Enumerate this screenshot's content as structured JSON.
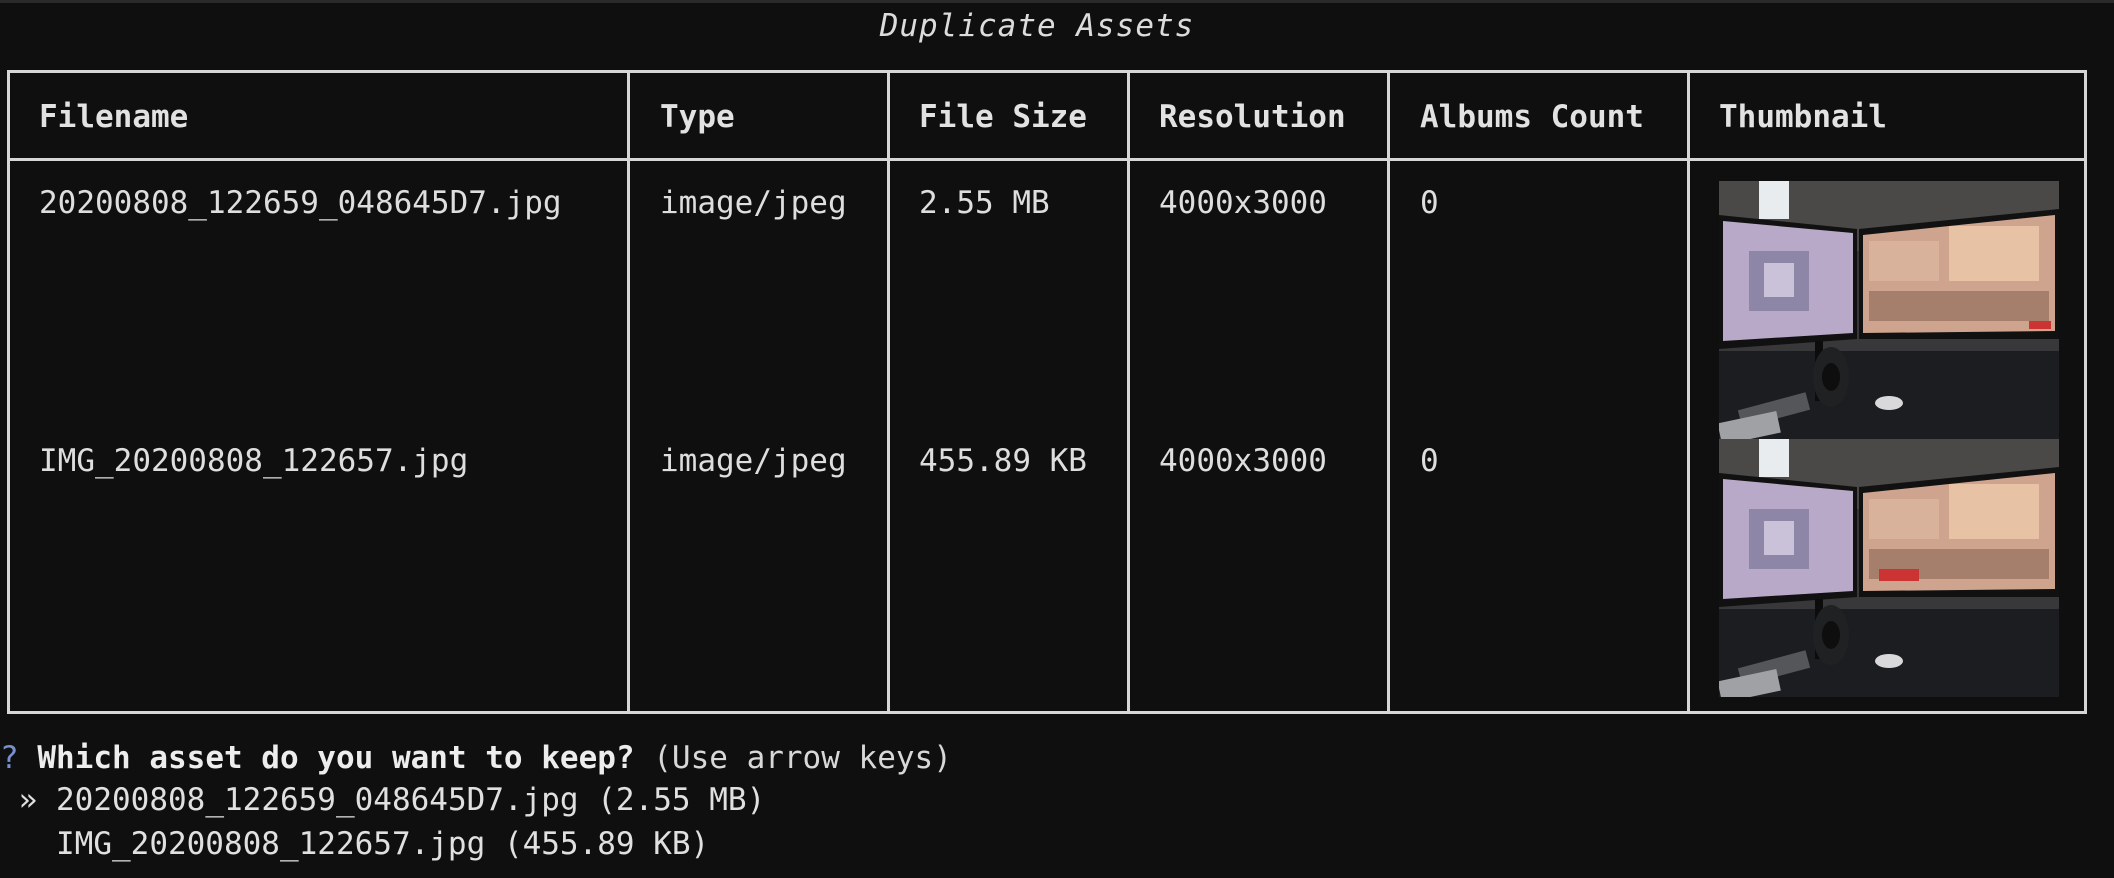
{
  "caption": "Duplicate Assets",
  "table": {
    "headers": [
      "Filename",
      "Type",
      "File Size",
      "Resolution",
      "Albums Count",
      "Thumbnail"
    ],
    "rows": [
      {
        "filename": "20200808_122659_048645D7.jpg",
        "type": "image/jpeg",
        "file_size": "2.55 MB",
        "resolution": "4000x3000",
        "albums_count": "0",
        "thumbnail": "desk-dual-monitor-photo"
      },
      {
        "filename": "IMG_20200808_122657.jpg",
        "type": "image/jpeg",
        "file_size": "455.89 KB",
        "resolution": "4000x3000",
        "albums_count": "0",
        "thumbnail": "desk-dual-monitor-photo"
      }
    ]
  },
  "prompt": {
    "marker": "?",
    "question": "Which asset do you want to keep?",
    "hint": "(Use arrow keys)",
    "pointer": "»",
    "choices": [
      "20200808_122659_048645D7.jpg (2.55 MB)",
      "IMG_20200808_122657.jpg (455.89 KB)"
    ],
    "selected_index": 0
  },
  "colors": {
    "background": "#0f0f0f",
    "border": "#d6d6d6",
    "prompt_marker": "#7a8fd0"
  }
}
